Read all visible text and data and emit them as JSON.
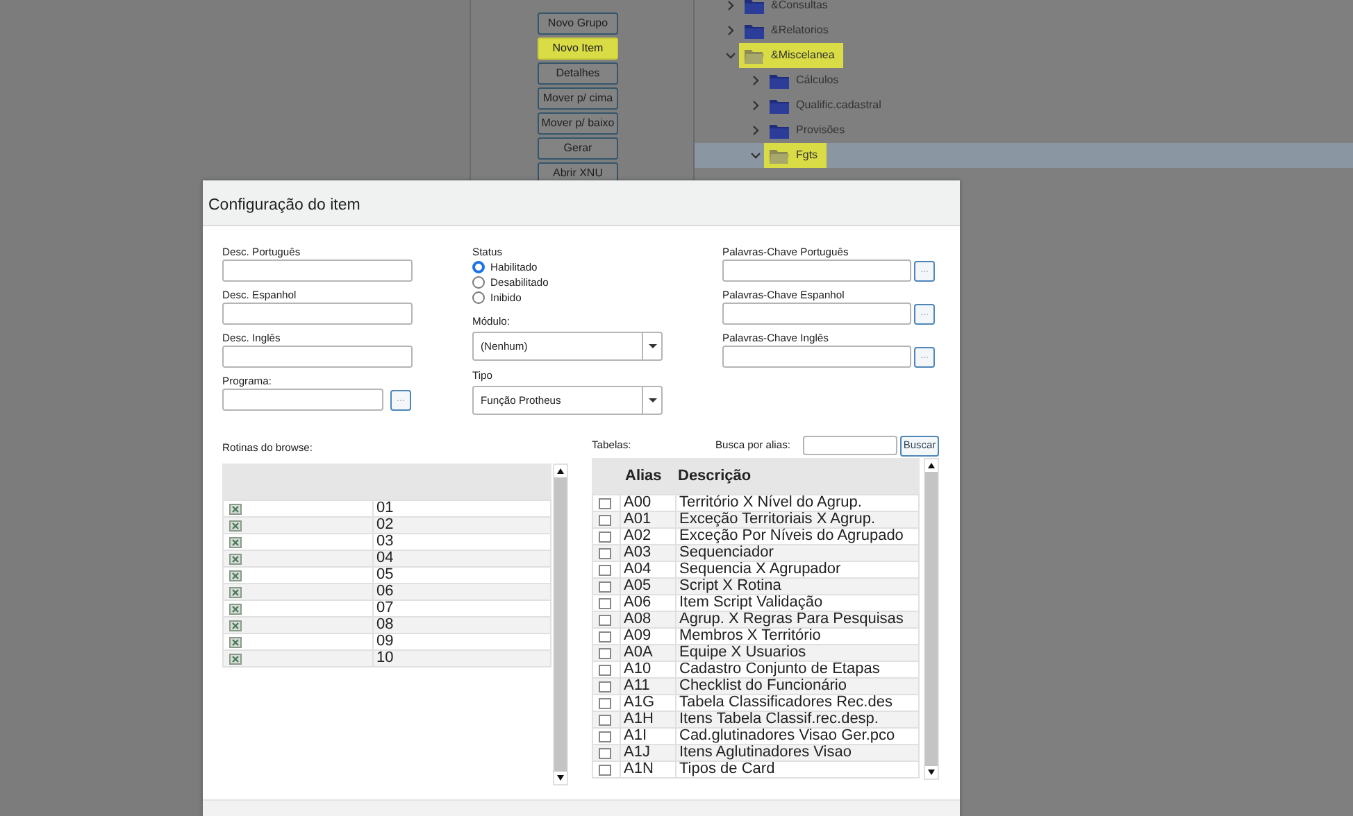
{
  "background": {
    "buttons": [
      {
        "label": "Novo Grupo",
        "highlighted": false
      },
      {
        "label": "Novo Item",
        "highlighted": true
      },
      {
        "label": "Detalhes",
        "highlighted": false
      },
      {
        "label": "Mover p/ cima",
        "highlighted": false
      },
      {
        "label": "Mover p/ baixo",
        "highlighted": false
      },
      {
        "label": "Gerar",
        "highlighted": false
      },
      {
        "label": "Abrir XNU",
        "highlighted": false
      }
    ],
    "tree": [
      {
        "label": "&Consultas",
        "expanded": false,
        "highlighted": false,
        "selected": false
      },
      {
        "label": "&Relatorios",
        "expanded": false,
        "highlighted": false,
        "selected": false
      },
      {
        "label": "&Miscelanea",
        "expanded": true,
        "highlighted": true,
        "selected": false,
        "children": [
          {
            "label": "Cálculos",
            "expanded": false,
            "highlighted": false,
            "selected": false
          },
          {
            "label": "Qualific.cadastral",
            "expanded": false,
            "highlighted": false,
            "selected": false
          },
          {
            "label": "Provisões",
            "expanded": false,
            "highlighted": false,
            "selected": false
          },
          {
            "label": "Fgts",
            "expanded": true,
            "highlighted": true,
            "selected": true
          }
        ]
      }
    ]
  },
  "dialog": {
    "title": "Configuração do item",
    "descriptions": [
      {
        "label": "Desc. Português"
      },
      {
        "label": "Desc. Espanhol"
      },
      {
        "label": "Desc. Inglês"
      }
    ],
    "program": {
      "label": "Programa:",
      "button": "..."
    },
    "status": {
      "label": "Status",
      "options": [
        {
          "label": "Habilitado",
          "selected": true
        },
        {
          "label": "Desabilitado",
          "selected": false
        },
        {
          "label": "Inibido",
          "selected": false
        }
      ]
    },
    "module": {
      "label": "Módulo:",
      "value": "(Nenhum)"
    },
    "type": {
      "label": "Tipo",
      "value": "Função Protheus"
    },
    "keywords": [
      {
        "label": "Palavras-Chave Português",
        "button": "..."
      },
      {
        "label": "Palavras-Chave Espanhol",
        "button": "..."
      },
      {
        "label": "Palavras-Chave Inglês",
        "button": "..."
      }
    ],
    "routines": {
      "label": "Rotinas do browse:",
      "rows": [
        {
          "checked": true,
          "value": "01"
        },
        {
          "checked": true,
          "value": "02"
        },
        {
          "checked": true,
          "value": "03"
        },
        {
          "checked": true,
          "value": "04"
        },
        {
          "checked": true,
          "value": "05"
        },
        {
          "checked": true,
          "value": "06"
        },
        {
          "checked": true,
          "value": "07"
        },
        {
          "checked": true,
          "value": "08"
        },
        {
          "checked": true,
          "value": "09"
        },
        {
          "checked": true,
          "value": "10"
        }
      ]
    },
    "tables": {
      "label": "Tabelas:",
      "search_label": "Busca por alias:",
      "search_button": "Buscar",
      "columns": [
        "Alias",
        "Descrição"
      ],
      "rows": [
        {
          "checked": false,
          "alias": "A00",
          "description": "Território X Nível do Agrup."
        },
        {
          "checked": false,
          "alias": "A01",
          "description": "Exceção Territoriais X Agrup."
        },
        {
          "checked": false,
          "alias": "A02",
          "description": "Exceção Por Níveis do Agrupado"
        },
        {
          "checked": false,
          "alias": "A03",
          "description": "Sequenciador"
        },
        {
          "checked": false,
          "alias": "A04",
          "description": "Sequencia X Agrupador"
        },
        {
          "checked": false,
          "alias": "A05",
          "description": "Script X Rotina"
        },
        {
          "checked": false,
          "alias": "A06",
          "description": "Item Script Validação"
        },
        {
          "checked": false,
          "alias": "A08",
          "description": "Agrup. X Regras Para Pesquisas"
        },
        {
          "checked": false,
          "alias": "A09",
          "description": "Membros X Território"
        },
        {
          "checked": false,
          "alias": "A0A",
          "description": "Equipe X Usuarios"
        },
        {
          "checked": false,
          "alias": "A10",
          "description": "Cadastro Conjunto de Etapas"
        },
        {
          "checked": false,
          "alias": "A11",
          "description": "Checklist do Funcionário"
        },
        {
          "checked": false,
          "alias": "A1G",
          "description": "Tabela Classificadores Rec.des"
        },
        {
          "checked": false,
          "alias": "A1H",
          "description": "Itens Tabela Classif.rec.desp."
        },
        {
          "checked": false,
          "alias": "A1I",
          "description": "Cad.glutinadores Visao Ger.pco"
        },
        {
          "checked": false,
          "alias": "A1J",
          "description": "Itens Aglutinadores Visao"
        },
        {
          "checked": false,
          "alias": "A1N",
          "description": "Tipos de Card"
        }
      ]
    }
  }
}
